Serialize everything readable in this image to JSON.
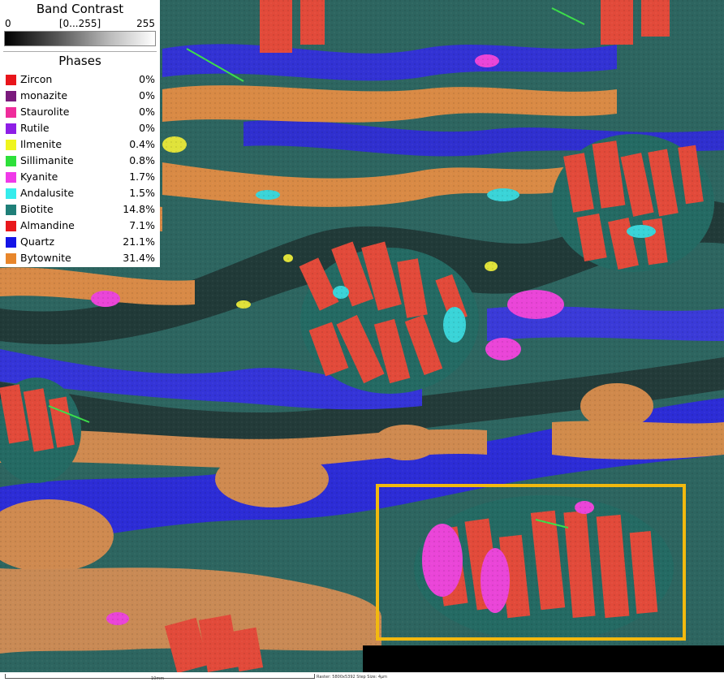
{
  "legend": {
    "band_contrast_title": "Band Contrast",
    "scale_min": "0",
    "scale_range": "[0...255]",
    "scale_max": "255",
    "phases_title": "Phases",
    "phases": [
      {
        "name": "Zircon",
        "percent": "0%",
        "color": "#e8151b"
      },
      {
        "name": "monazite",
        "percent": "0%",
        "color": "#7a1a7c"
      },
      {
        "name": "Staurolite",
        "percent": "0%",
        "color": "#ef2c9b"
      },
      {
        "name": "Rutile",
        "percent": "0%",
        "color": "#8e1ee6"
      },
      {
        "name": "Ilmenite",
        "percent": "0.4%",
        "color": "#eff51d"
      },
      {
        "name": "Sillimanite",
        "percent": "0.8%",
        "color": "#2de03a"
      },
      {
        "name": "Kyanite",
        "percent": "1.7%",
        "color": "#f039e8"
      },
      {
        "name": "Andalusite",
        "percent": "1.5%",
        "color": "#35ecec"
      },
      {
        "name": "Biotite",
        "percent": "14.8%",
        "color": "#1f7f78"
      },
      {
        "name": "Almandine",
        "percent": "7.1%",
        "color": "#e8181c"
      },
      {
        "name": "Quartz",
        "percent": "21.1%",
        "color": "#1414e6"
      },
      {
        "name": "Bytownite",
        "percent": "31.4%",
        "color": "#e8862b"
      }
    ]
  },
  "footer": {
    "scale_label": "10mm",
    "raster_info": "Raster: 5800x5392   Step Size: 4µm"
  }
}
